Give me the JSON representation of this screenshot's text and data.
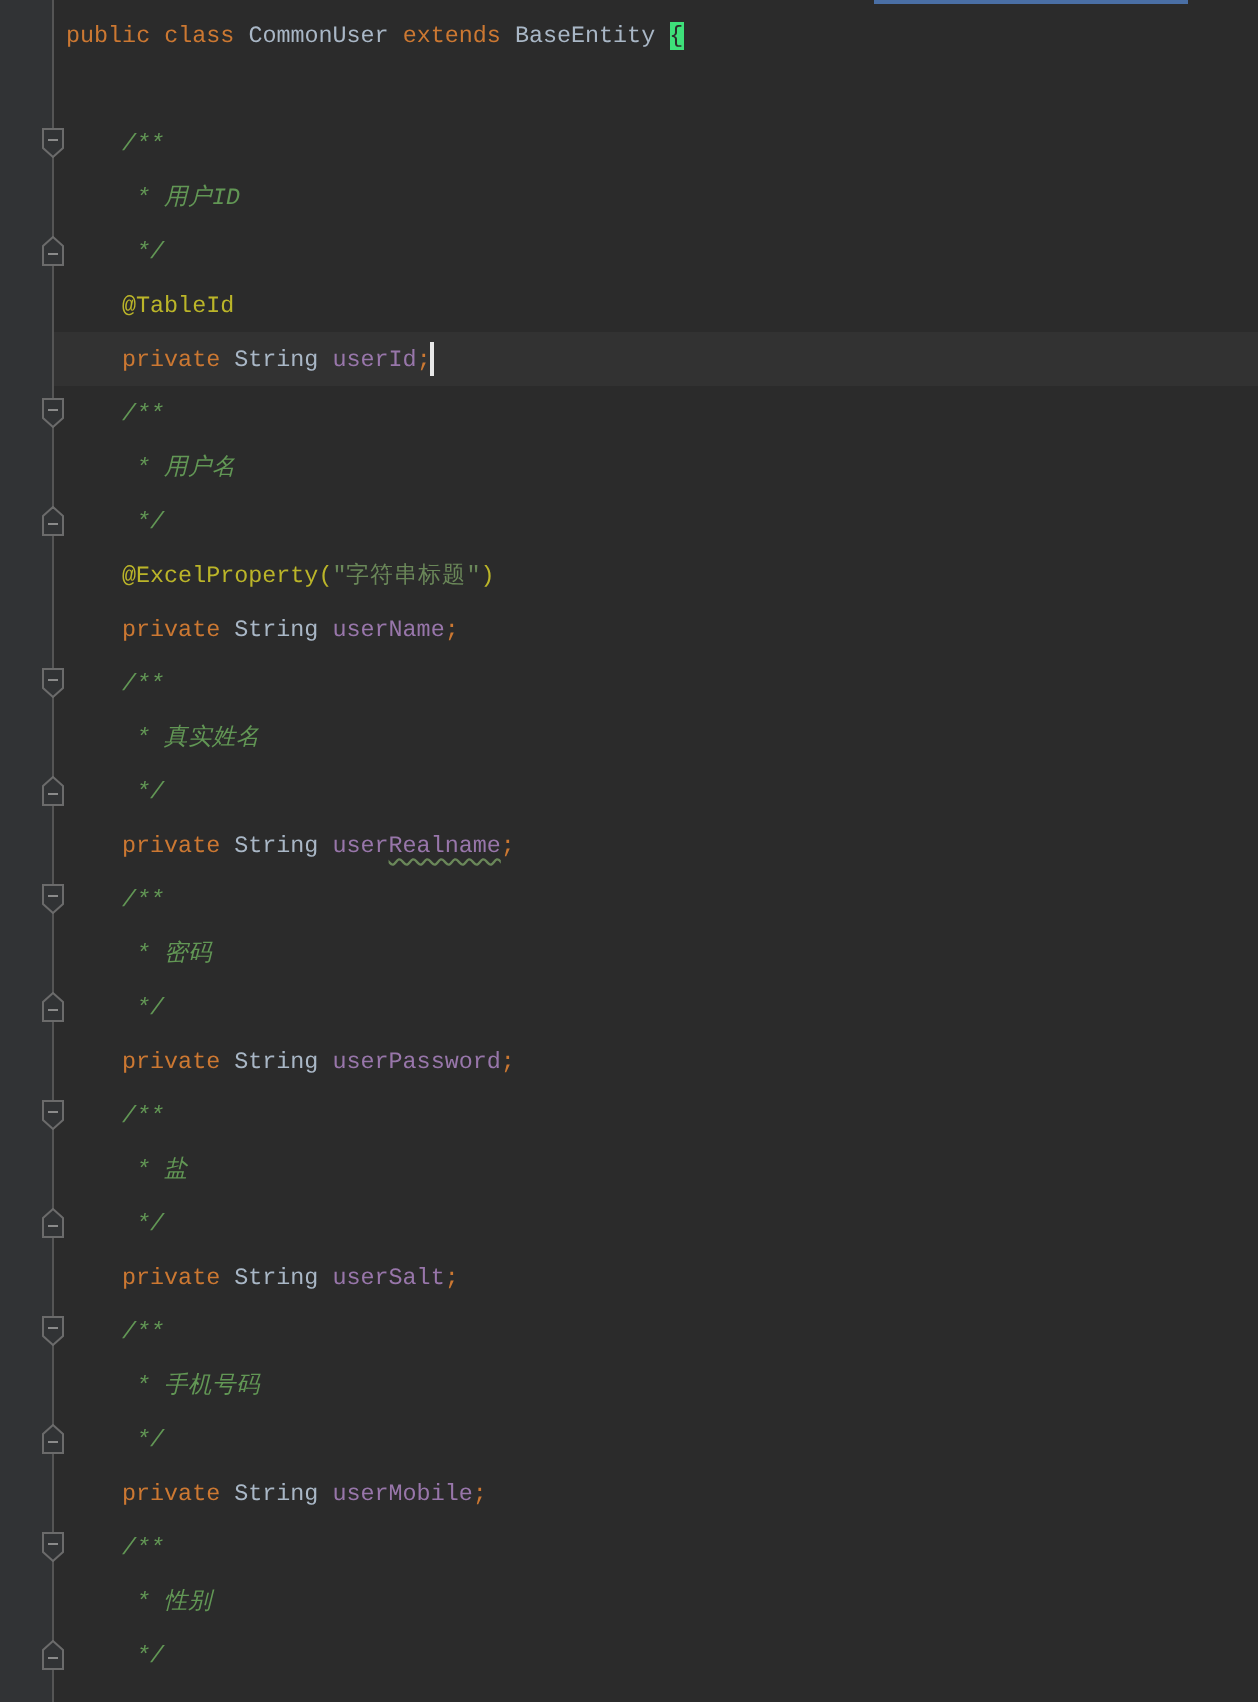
{
  "editor": {
    "lines": [
      {
        "kind": "code",
        "fold_start": false,
        "fold_end": false,
        "current": false,
        "tokens": [
          {
            "kind": "keyword",
            "text": "public class "
          },
          {
            "kind": "type",
            "text": "CommonUser "
          },
          {
            "kind": "keyword",
            "text": "extends "
          },
          {
            "kind": "type",
            "text": "BaseEntity "
          },
          {
            "kind": "brace",
            "text": "{"
          }
        ],
        "children": [
          {
            "kind": "blank"
          },
          {
            "kind": "code",
            "fold_start": true,
            "fold_end": false,
            "current": false,
            "tokens": [
              {
                "kind": "comment",
                "text": "/**"
              }
            ]
          },
          {
            "kind": "code",
            "fold_start": false,
            "fold_end": false,
            "current": false,
            "tokens": [
              {
                "kind": "comment",
                "text": " * 用户ID"
              }
            ]
          },
          {
            "kind": "code",
            "fold_start": false,
            "fold_end": true,
            "current": false,
            "tokens": [
              {
                "kind": "comment",
                "text": " */"
              }
            ]
          },
          {
            "kind": "code",
            "fold_start": false,
            "fold_end": false,
            "current": false,
            "tokens": [
              {
                "kind": "annotation",
                "text": "@TableId"
              }
            ]
          },
          {
            "kind": "code",
            "fold_start": false,
            "fold_end": false,
            "current": true,
            "tokens": [
              {
                "kind": "keyword",
                "text": "private "
              },
              {
                "kind": "type",
                "text": "String "
              },
              {
                "kind": "field",
                "text": "userId"
              },
              {
                "kind": "punct",
                "text": ";"
              }
            ]
          },
          {
            "kind": "code",
            "fold_start": true,
            "fold_end": false,
            "current": false,
            "tokens": [
              {
                "kind": "comment",
                "text": "/**"
              }
            ]
          },
          {
            "kind": "code",
            "fold_start": false,
            "fold_end": false,
            "current": false,
            "tokens": [
              {
                "kind": "comment",
                "text": " * 用户名"
              }
            ]
          },
          {
            "kind": "code",
            "fold_start": false,
            "fold_end": true,
            "current": false,
            "tokens": [
              {
                "kind": "comment",
                "text": " */"
              }
            ]
          },
          {
            "kind": "code",
            "fold_start": false,
            "fold_end": false,
            "current": false,
            "tokens": [
              {
                "kind": "annotation",
                "text": "@ExcelProperty("
              },
              {
                "kind": "string",
                "text": "\"字符串标题\""
              },
              {
                "kind": "annotation",
                "text": ")"
              }
            ]
          },
          {
            "kind": "code",
            "fold_start": false,
            "fold_end": false,
            "current": false,
            "tokens": [
              {
                "kind": "keyword",
                "text": "private "
              },
              {
                "kind": "type",
                "text": "String "
              },
              {
                "kind": "field",
                "text": "userName"
              },
              {
                "kind": "punct",
                "text": ";"
              }
            ]
          },
          {
            "kind": "code",
            "fold_start": true,
            "fold_end": false,
            "current": false,
            "tokens": [
              {
                "kind": "comment",
                "text": "/**"
              }
            ]
          },
          {
            "kind": "code",
            "fold_start": false,
            "fold_end": false,
            "current": false,
            "tokens": [
              {
                "kind": "comment",
                "text": " * 真实姓名"
              }
            ]
          },
          {
            "kind": "code",
            "fold_start": false,
            "fold_end": true,
            "current": false,
            "tokens": [
              {
                "kind": "comment",
                "text": " */"
              }
            ]
          },
          {
            "kind": "code",
            "fold_start": false,
            "fold_end": false,
            "current": false,
            "tokens": [
              {
                "kind": "keyword",
                "text": "private "
              },
              {
                "kind": "type",
                "text": "String "
              },
              {
                "kind": "field",
                "text": "user"
              },
              {
                "kind": "typo",
                "text": "Realname"
              },
              {
                "kind": "punct",
                "text": ";"
              }
            ]
          },
          {
            "kind": "code",
            "fold_start": true,
            "fold_end": false,
            "current": false,
            "tokens": [
              {
                "kind": "comment",
                "text": "/**"
              }
            ]
          },
          {
            "kind": "code",
            "fold_start": false,
            "fold_end": false,
            "current": false,
            "tokens": [
              {
                "kind": "comment",
                "text": " * 密码"
              }
            ]
          },
          {
            "kind": "code",
            "fold_start": false,
            "fold_end": true,
            "current": false,
            "tokens": [
              {
                "kind": "comment",
                "text": " */"
              }
            ]
          },
          {
            "kind": "code",
            "fold_start": false,
            "fold_end": false,
            "current": false,
            "tokens": [
              {
                "kind": "keyword",
                "text": "private "
              },
              {
                "kind": "type",
                "text": "String "
              },
              {
                "kind": "field",
                "text": "userPassword"
              },
              {
                "kind": "punct",
                "text": ";"
              }
            ]
          },
          {
            "kind": "code",
            "fold_start": true,
            "fold_end": false,
            "current": false,
            "tokens": [
              {
                "kind": "comment",
                "text": "/**"
              }
            ]
          },
          {
            "kind": "code",
            "fold_start": false,
            "fold_end": false,
            "current": false,
            "tokens": [
              {
                "kind": "comment",
                "text": " * 盐"
              }
            ]
          },
          {
            "kind": "code",
            "fold_start": false,
            "fold_end": true,
            "current": false,
            "tokens": [
              {
                "kind": "comment",
                "text": " */"
              }
            ]
          },
          {
            "kind": "code",
            "fold_start": false,
            "fold_end": false,
            "current": false,
            "tokens": [
              {
                "kind": "keyword",
                "text": "private "
              },
              {
                "kind": "type",
                "text": "String "
              },
              {
                "kind": "field",
                "text": "userSalt"
              },
              {
                "kind": "punct",
                "text": ";"
              }
            ]
          },
          {
            "kind": "code",
            "fold_start": true,
            "fold_end": false,
            "current": false,
            "tokens": [
              {
                "kind": "comment",
                "text": "/**"
              }
            ]
          },
          {
            "kind": "code",
            "fold_start": false,
            "fold_end": false,
            "current": false,
            "tokens": [
              {
                "kind": "comment",
                "text": " * 手机号码"
              }
            ]
          },
          {
            "kind": "code",
            "fold_start": false,
            "fold_end": true,
            "current": false,
            "tokens": [
              {
                "kind": "comment",
                "text": " */"
              }
            ]
          },
          {
            "kind": "code",
            "fold_start": false,
            "fold_end": false,
            "current": false,
            "tokens": [
              {
                "kind": "keyword",
                "text": "private "
              },
              {
                "kind": "type",
                "text": "String "
              },
              {
                "kind": "field",
                "text": "userMobile"
              },
              {
                "kind": "punct",
                "text": ";"
              }
            ]
          },
          {
            "kind": "code",
            "fold_start": true,
            "fold_end": false,
            "current": false,
            "tokens": [
              {
                "kind": "comment",
                "text": "/**"
              }
            ]
          },
          {
            "kind": "code",
            "fold_start": false,
            "fold_end": false,
            "current": false,
            "tokens": [
              {
                "kind": "comment",
                "text": " * 性别"
              }
            ]
          },
          {
            "kind": "code",
            "fold_start": false,
            "fold_end": true,
            "current": false,
            "tokens": [
              {
                "kind": "comment",
                "text": " */"
              }
            ]
          }
        ]
      }
    ]
  }
}
